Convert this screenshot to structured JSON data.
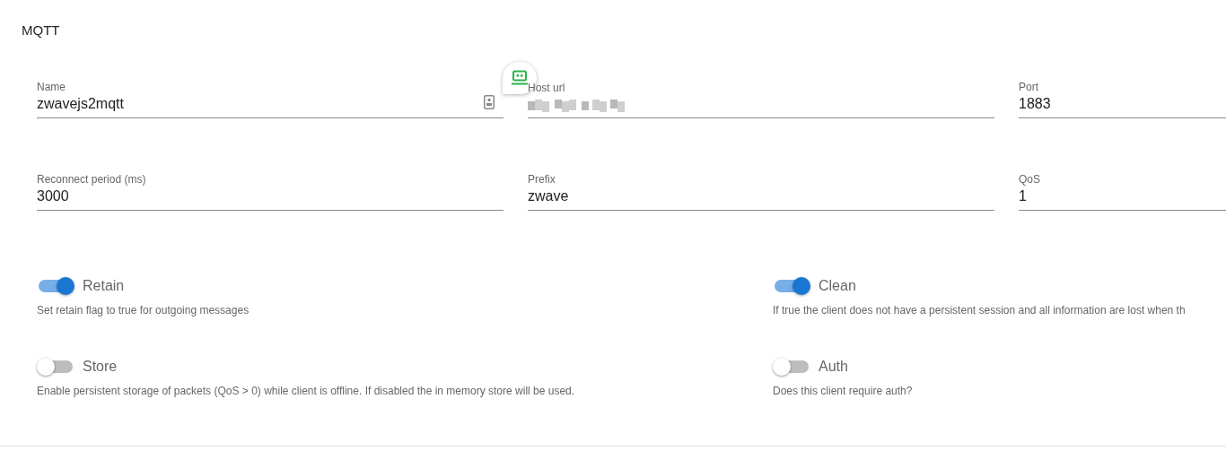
{
  "title": "MQTT",
  "fields": [
    {
      "label": "Name",
      "value": "zwavejs2mqtt",
      "redacted": false,
      "autofill_badge": true
    },
    {
      "label": "Host url",
      "redacted": true,
      "autofill_badge": false
    },
    {
      "label": "Port",
      "value": "1883",
      "redacted": false,
      "autofill_badge": false
    },
    {
      "label": "Reconnect period (ms)",
      "value": "3000",
      "redacted": false,
      "autofill_badge": false
    },
    {
      "label": "Prefix",
      "value": "zwave",
      "redacted": false,
      "autofill_badge": false
    },
    {
      "label": "QoS",
      "value": "1",
      "redacted": false,
      "autofill_badge": false
    }
  ],
  "switches": [
    {
      "label": "Retain",
      "on": true,
      "hint": "Set retain flag to true for outgoing messages"
    },
    {
      "label": "Clean",
      "on": true,
      "hint": "If true the client does not have a persistent session and all information are lost when th"
    },
    {
      "label": "Store",
      "on": false,
      "hint": "Enable persistent storage of packets (QoS > 0) while client is offline. If disabled the in memory store will be used."
    },
    {
      "label": "Auth",
      "on": false,
      "hint": "Does this client require auth?"
    }
  ]
}
